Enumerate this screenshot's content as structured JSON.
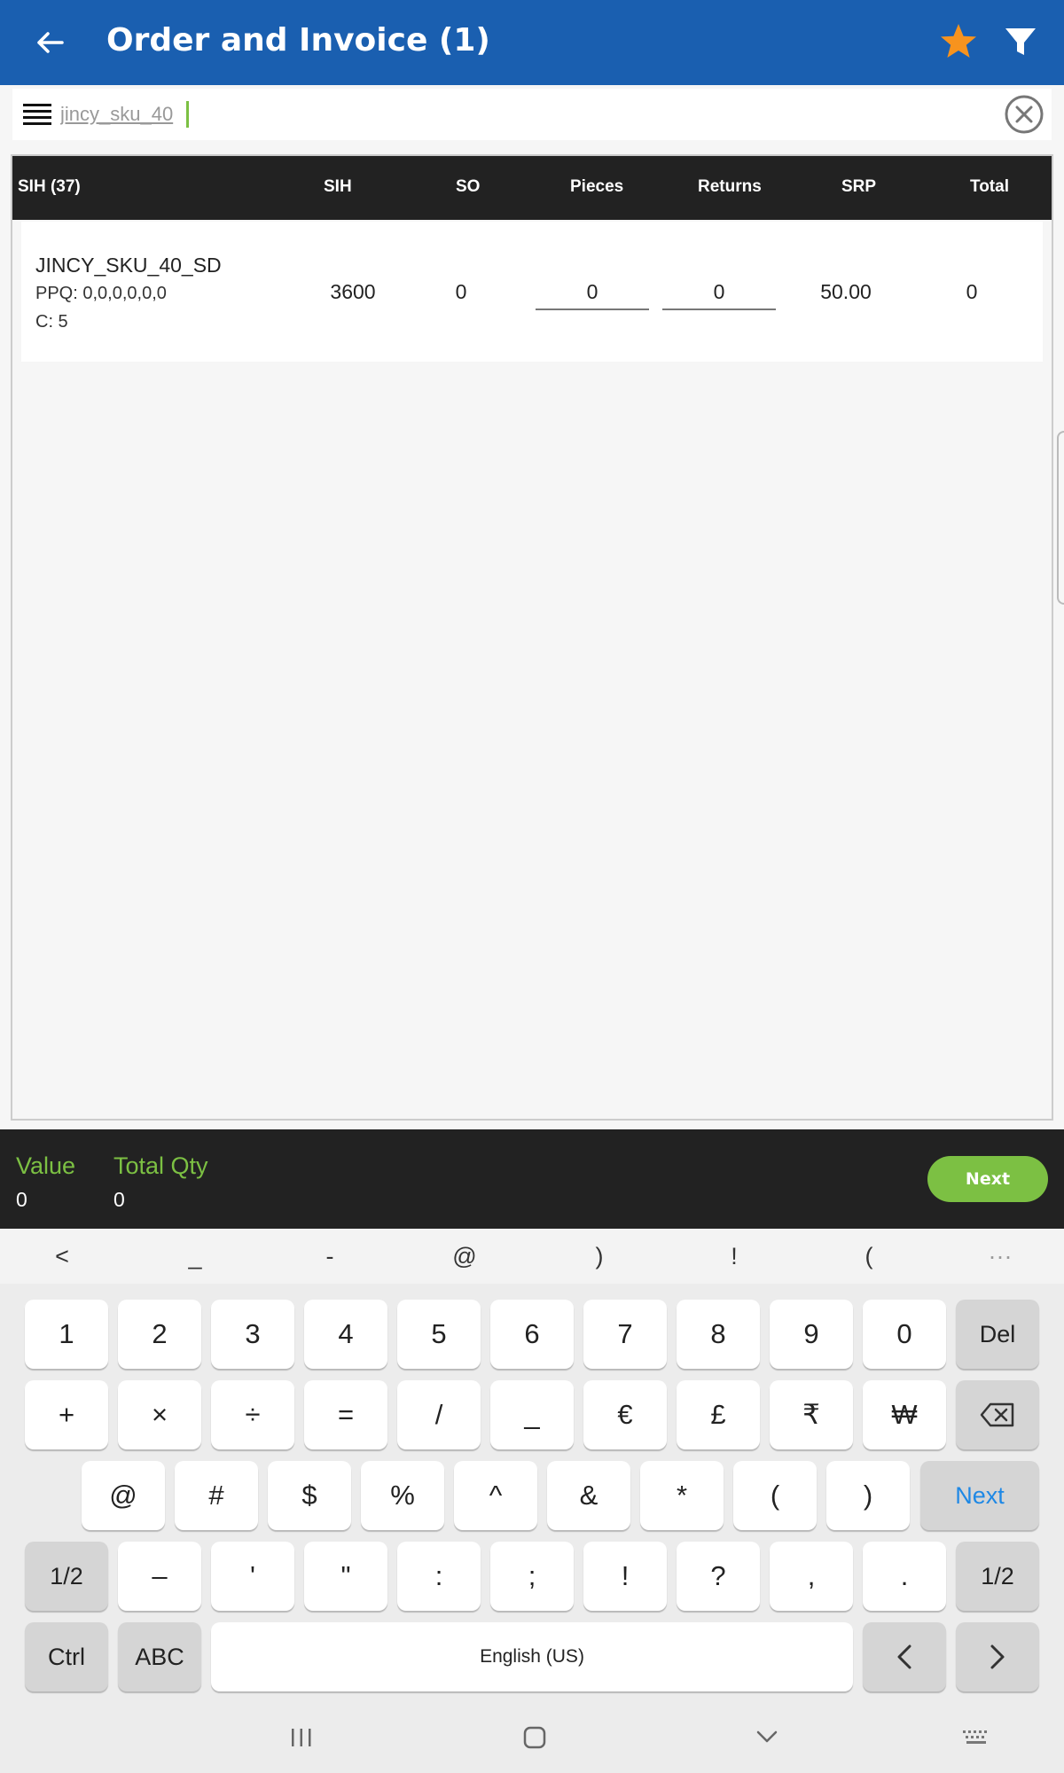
{
  "app_bar": {
    "title": "Order and  Invoice (1)",
    "icons": [
      "arrow-left-icon",
      "star-icon",
      "filter-icon"
    ],
    "colors": {
      "background": "#1a5fb0",
      "star": "#f7931e"
    }
  },
  "search": {
    "value": "jincy_sku_40",
    "icons": [
      "menu-icon",
      "clear-icon"
    ]
  },
  "table": {
    "headers": [
      "SIH (37)",
      "SIH",
      "SO",
      "Pieces",
      "Returns",
      "SRP",
      "Total"
    ],
    "rows": [
      {
        "name": "JINCY_SKU_40_SD",
        "ppq": "PPQ: 0,0,0,0,0,0",
        "c": "C: 5",
        "sih": "3600",
        "so": "0",
        "pieces": "0",
        "returns": "0",
        "srp": "50.00",
        "total": "0"
      }
    ]
  },
  "footer": {
    "value_label": "Value",
    "value": "0",
    "qty_label": "Total Qty",
    "qty": "0",
    "next_label": "Next",
    "colors": {
      "accent": "#7cc043"
    }
  },
  "keyboard": {
    "suggestions": [
      "<",
      "_",
      "-",
      "@",
      ")",
      "!",
      "(",
      "···"
    ],
    "row1": [
      "1",
      "2",
      "3",
      "4",
      "5",
      "6",
      "7",
      "8",
      "9",
      "0",
      "Del"
    ],
    "row2": [
      "+",
      "×",
      "÷",
      "=",
      "/",
      "_",
      "€",
      "£",
      "₹",
      "₩"
    ],
    "row3": [
      "@",
      "#",
      "$",
      "%",
      "^",
      "&",
      "*",
      "(",
      ")",
      "Next"
    ],
    "row4": [
      "1/2",
      "–",
      "'",
      "\"",
      ":",
      ";",
      "!",
      "?",
      ",",
      ".",
      "1/2"
    ],
    "row5": [
      "Ctrl",
      "ABC",
      "English (US)"
    ],
    "icons": [
      "backspace-icon",
      "arrow-left-key-icon",
      "arrow-right-key-icon"
    ]
  },
  "nav_bar": {
    "icons": [
      "recent-apps-icon",
      "home-icon",
      "back-down-icon",
      "keyboard-icon"
    ]
  }
}
